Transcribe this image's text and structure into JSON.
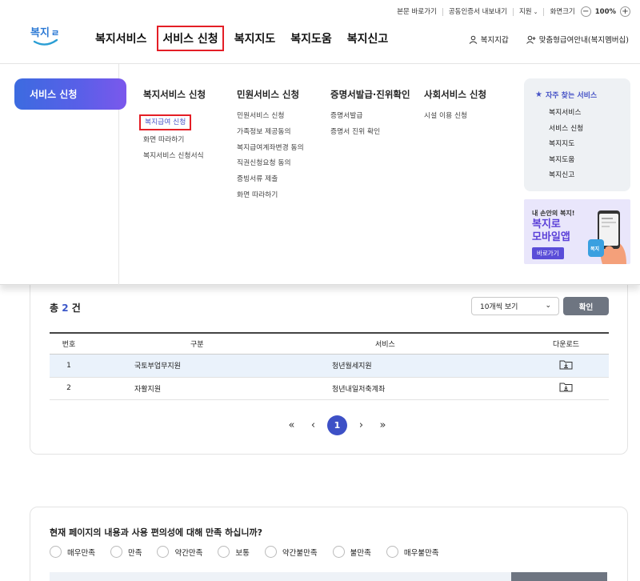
{
  "utility": {
    "skip": "본문 바로가기",
    "cert": "공동인증서 내보내기",
    "lang": "지원",
    "zoom_label": "화면크기",
    "zoom_value": "100%",
    "minus": "−",
    "plus": "+"
  },
  "logo": {
    "text": "복지로"
  },
  "gnb": [
    "복지서비스",
    "서비스 신청",
    "복지지도",
    "복지도움",
    "복지신고"
  ],
  "header_right": {
    "wallet": "복지지갑",
    "custom": "맞춤형급여안내(복지멤버십)"
  },
  "mega": {
    "tab": "서비스 신청",
    "columns": [
      {
        "title": "복지서비스 신청",
        "items": [
          "복지급여 신청",
          "화면 따라하기",
          "복지서비스 신청서식"
        ]
      },
      {
        "title": "민원서비스 신청",
        "items": [
          "민원서비스 신청",
          "가족정보 제공동의",
          "복지급여계좌변경 동의",
          "직권신청요청 동의",
          "증빙서류 제출",
          "화면 따라하기"
        ]
      },
      {
        "title": "증명서발급·진위확인",
        "items": [
          "증명서발급",
          "증명서 진위 확인"
        ]
      },
      {
        "title": "사회서비스 신청",
        "items": [
          "시설 이용 신청"
        ]
      }
    ],
    "frequent": {
      "title": "자주 찾는 서비스",
      "items": [
        "복지서비스",
        "서비스 신청",
        "복지지도",
        "복지도움",
        "복지신고"
      ]
    },
    "banner": {
      "line1": "내 손안의 복지!",
      "line2": "복지로",
      "line3": "모바일앱",
      "button": "바로가기"
    }
  },
  "list": {
    "total_prefix": "총",
    "total_count": "2",
    "total_suffix": "건",
    "page_size": "10개씩 보기",
    "confirm": "확인",
    "headers": {
      "no": "번호",
      "category": "구분",
      "service": "서비스",
      "download": "다운로드"
    },
    "rows": [
      {
        "no": "1",
        "category": "국토부업무지원",
        "service": "청년월세지원"
      },
      {
        "no": "2",
        "category": "자활지원",
        "service": "청년내일저축계좌"
      }
    ],
    "current_page": "1"
  },
  "survey": {
    "question": "현재 페이지의 내용과 사용 편의성에 대해 만족 하십니까?",
    "options": [
      "매우만족",
      "만족",
      "약간만족",
      "보통",
      "약간불만족",
      "불만족",
      "매우불만족"
    ]
  },
  "colors": {
    "accent": "#3d50c6",
    "highlight": "#e41e26",
    "button": "#6e7581"
  }
}
